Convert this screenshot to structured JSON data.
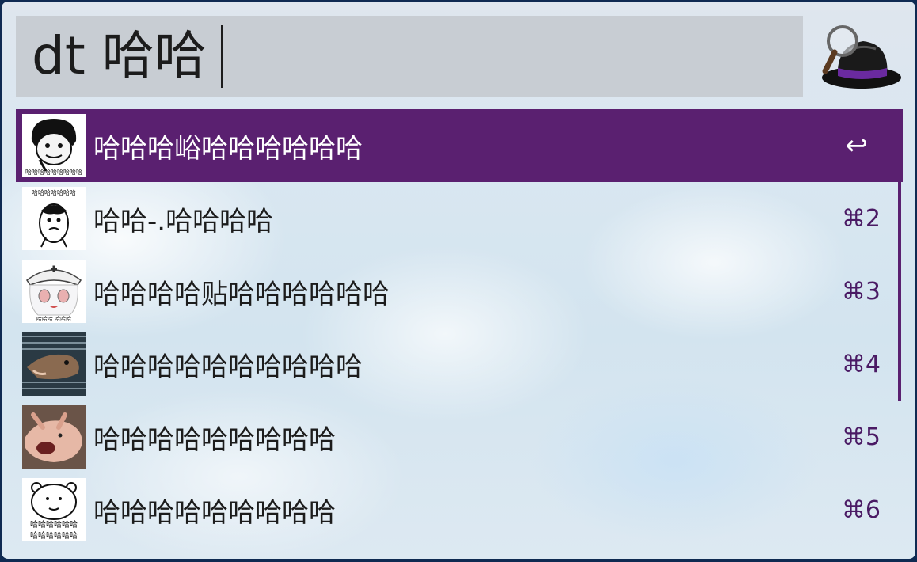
{
  "search": {
    "query": "dt 哈哈"
  },
  "app": {
    "logo_icon": "alfred-hat-magnifier-icon",
    "accent_color": "#5a2070"
  },
  "results": [
    {
      "title": "哈哈哈峪哈哈哈哈哈哈",
      "shortcut": "↩",
      "thumbnail": "meme-face-icon",
      "selected": true
    },
    {
      "title": "哈哈-.哈哈哈哈",
      "shortcut": "⌘2",
      "thumbnail": "meme-face-icon",
      "selected": false
    },
    {
      "title": "哈哈哈哈贴哈哈哈哈哈哈",
      "shortcut": "⌘3",
      "thumbnail": "anime-girl-icon",
      "selected": false
    },
    {
      "title": "哈哈哈哈哈哈哈哈哈哈",
      "shortcut": "⌘4",
      "thumbnail": "dog-photo-icon",
      "selected": false
    },
    {
      "title": "哈哈哈哈哈哈哈哈哈",
      "shortcut": "⌘5",
      "thumbnail": "pig-photo-icon",
      "selected": false
    },
    {
      "title": "哈哈哈哈哈哈哈哈哈",
      "shortcut": "⌘6",
      "thumbnail": "bear-meme-icon",
      "selected": false
    }
  ],
  "thumb_text": {
    "t0": "哈哈哈哈哈哈哈哈哈",
    "t1": "哈哈哈哈哈哈哈",
    "t2": "哈哈哈  哈哈哈",
    "t5a": "哈哈哈哈哈哈",
    "t5b": "哈哈哈哈哈哈"
  }
}
